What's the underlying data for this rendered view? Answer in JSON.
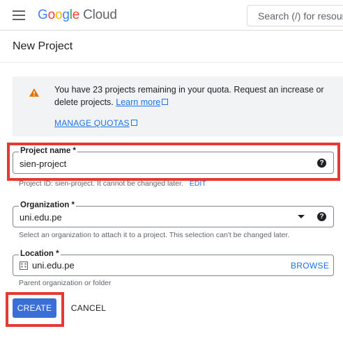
{
  "header": {
    "logo_letters": [
      "G",
      "o",
      "o",
      "g",
      "l",
      "e"
    ],
    "logo_product": "Cloud",
    "search_placeholder": "Search (/) for resources"
  },
  "page": {
    "title": "New Project"
  },
  "quota_notice": {
    "icon": "warning-icon",
    "message": "You have 23 projects remaining in your quota. Request an increase or delete projects.",
    "learn_more": "Learn more",
    "manage_quotas": "MANAGE QUOTAS"
  },
  "form": {
    "project_name": {
      "label": "Project name *",
      "value": "sien-project",
      "hint": "Project ID: sien-project. It cannot be changed later.",
      "edit": "EDIT"
    },
    "organization": {
      "label": "Organization *",
      "value": "uni.edu.pe",
      "hint": "Select an organization to attach it to a project. This selection can't be changed later."
    },
    "location": {
      "label": "Location *",
      "value": "uni.edu.pe",
      "browse": "BROWSE",
      "hint": "Parent organization or folder"
    }
  },
  "actions": {
    "create": "CREATE",
    "cancel": "CANCEL"
  },
  "colors": {
    "primary": "#3b6fd8",
    "link": "#1a73e8",
    "warning": "#e37400",
    "highlight": "#e53935"
  }
}
